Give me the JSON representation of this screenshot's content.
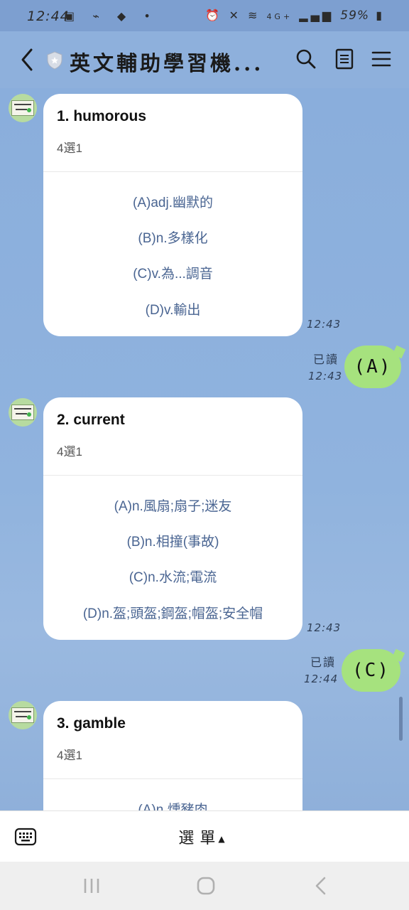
{
  "status_bar": {
    "time": "12:44",
    "left_icons": [
      "gallery-icon",
      "voicemail-icon",
      "navigation-icon",
      "dot-icon"
    ],
    "network": "4G+",
    "battery": "59%"
  },
  "header": {
    "title": "英文輔助學習機...",
    "back_icon": "chevron-left-icon",
    "badge_icon": "shield-icon",
    "actions": [
      "search-icon",
      "notes-icon",
      "menu-icon"
    ]
  },
  "messages": [
    {
      "title": "1. humorous",
      "subtitle": "4選1",
      "options": [
        "(A)adj.幽默的",
        "(B)n.多樣化",
        "(C)v.為...調音",
        "(D)v.輸出"
      ],
      "time": "12:43"
    },
    {
      "reply": "(A)",
      "read": "已讀",
      "time": "12:43"
    },
    {
      "title": "2. current",
      "subtitle": "4選1",
      "options": [
        "(A)n.風扇;扇子;迷友",
        "(B)n.相撞(事故)",
        "(C)n.水流;電流",
        "(D)n.盔;頭盔;鋼盔;帽盔;安全帽"
      ],
      "time": "12:43"
    },
    {
      "reply": "(C)",
      "read": "已讀",
      "time": "12:44"
    },
    {
      "title": "3. gamble",
      "subtitle": "4選1",
      "options": [
        "(A)n.燻豬肉"
      ]
    }
  ],
  "bottom_bar": {
    "menu_label": "選單",
    "caret": "▲"
  },
  "colors": {
    "chat_background": "#8eb0dc",
    "my_bubble": "#a6e27e",
    "option_text": "#4a6592"
  }
}
